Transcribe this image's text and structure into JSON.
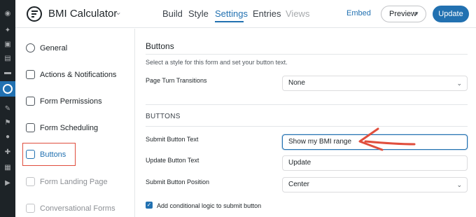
{
  "app": {
    "title": "BMI Calculator"
  },
  "nav": {
    "tabs": [
      {
        "label": "Build"
      },
      {
        "label": "Style"
      },
      {
        "label": "Settings",
        "active": true
      },
      {
        "label": "Entries"
      },
      {
        "label": "Views",
        "disabled": true
      }
    ],
    "embed_label": "Embed",
    "preview_label": "Preview",
    "update_label": "Update"
  },
  "sidebar": {
    "items": [
      {
        "label": "General",
        "icon": "gear-icon"
      },
      {
        "label": "Actions & Notifications",
        "icon": "megaphone-icon"
      },
      {
        "label": "Form Permissions",
        "icon": "lock-icon"
      },
      {
        "label": "Form Scheduling",
        "icon": "calendar-icon"
      },
      {
        "label": "Buttons",
        "icon": "button-icon",
        "active": true
      },
      {
        "label": "Form Landing Page",
        "icon": "document-icon",
        "disabled": true
      },
      {
        "label": "Conversational Forms",
        "icon": "chat-icon",
        "disabled": true
      }
    ]
  },
  "main": {
    "section_title": "Buttons",
    "section_desc": "Select a style for this form and set your button text.",
    "page_turn": {
      "label": "Page Turn Transitions",
      "value": "None"
    },
    "group_title": "BUTTONS",
    "submit_text": {
      "label": "Submit Button Text",
      "value": "Show my BMI range"
    },
    "update_text": {
      "label": "Update Button Text",
      "value": "Update"
    },
    "submit_position": {
      "label": "Submit Button Position",
      "value": "Center"
    },
    "conditional_logic": {
      "label": "Add conditional logic to submit button",
      "checked": true
    }
  },
  "colors": {
    "accent": "#2271b1",
    "annotation": "#e04e3d",
    "admin_bar": "#1d2327"
  }
}
